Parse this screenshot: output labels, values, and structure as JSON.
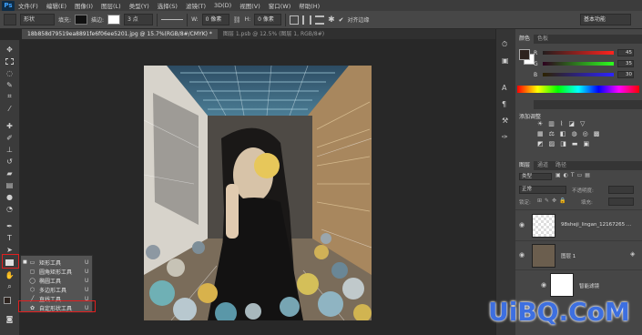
{
  "app": {
    "logo": "Ps"
  },
  "menu": [
    "文件(F)",
    "编辑(E)",
    "图像(I)",
    "图层(L)",
    "类型(Y)",
    "选择(S)",
    "滤镜(T)",
    "3D(D)",
    "视图(V)",
    "窗口(W)",
    "帮助(H)"
  ],
  "options": {
    "shape_mode": "形状",
    "fill_label": "填充:",
    "stroke_label": "描边:",
    "stroke_size": "3 点",
    "width_label": "W:",
    "width_value": "0 像素",
    "height_label": "H:",
    "height_value": "0 像素",
    "align_edges_label": "对齐边缘",
    "workspace": "基本功能"
  },
  "tabs": [
    {
      "label": "18b858d79519ea8891fe6f06ee5201.jpg @ 15.7%(RGB/8#/CMYK) *",
      "active": true
    },
    {
      "label": "图层 1.psb @ 12.5% (图层 1, RGB/8#)",
      "active": false
    }
  ],
  "flyout": {
    "items": [
      {
        "label": "矩形工具",
        "key": "U",
        "icon": "rectangle-icon"
      },
      {
        "label": "圆角矩形工具",
        "key": "U",
        "icon": "rounded-rectangle-icon"
      },
      {
        "label": "椭圆工具",
        "key": "U",
        "icon": "ellipse-icon"
      },
      {
        "label": "多边形工具",
        "key": "U",
        "icon": "polygon-icon"
      },
      {
        "label": "直线工具",
        "key": "U",
        "icon": "line-icon"
      },
      {
        "label": "自定形状工具",
        "key": "U",
        "icon": "custom-shape-icon"
      }
    ]
  },
  "color_panel": {
    "tabs": [
      "颜色",
      "色板"
    ],
    "channels": [
      {
        "name": "R",
        "value": "45"
      },
      {
        "name": "G",
        "value": "35"
      },
      {
        "name": "B",
        "value": "30"
      }
    ],
    "colors": {
      "foreground": "#2d231e",
      "background": "#ffffff"
    }
  },
  "adjustments_panel": {
    "title": "添加调整"
  },
  "layers_panel": {
    "tabs": [
      "图层",
      "通道",
      "路径"
    ],
    "kind_label": "类型",
    "blend_mode": "正常",
    "lock_label": "锁定:",
    "opacity_label": "不透明度:",
    "fill_label": "填充:",
    "layers": [
      {
        "name": "98sheji_lingan_12167265 ..."
      },
      {
        "name": "图层 1"
      },
      {
        "name": "智能滤镜"
      }
    ]
  },
  "watermark": "UiBQ.CoM"
}
